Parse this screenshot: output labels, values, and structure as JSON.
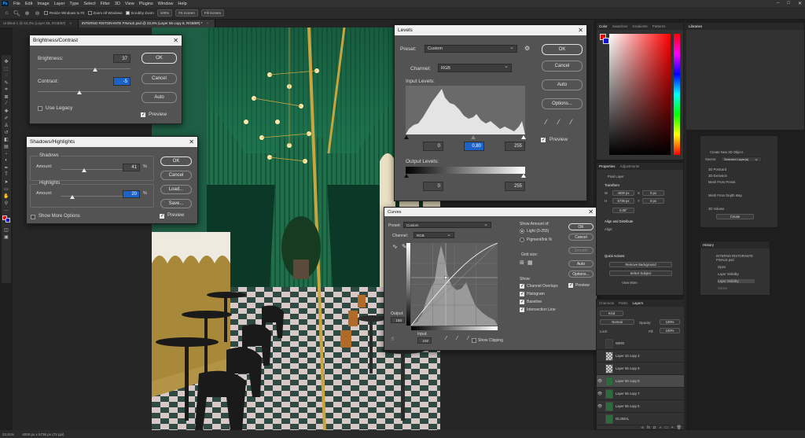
{
  "app": {
    "menu": [
      "File",
      "Edit",
      "Image",
      "Layer",
      "Type",
      "Select",
      "Filter",
      "3D",
      "View",
      "Plugins",
      "Window",
      "Help"
    ],
    "logo": "Ps"
  },
  "options_bar": {
    "resize_windows": "Resize Windows to Fit",
    "zoom_all_windows": "Zoom All Windows",
    "scrubby_zoom": "Scrubby Zoom",
    "zoom_pct": "100%",
    "fit_screen": "Fit Screen",
    "fill_screen": "Fill Screen"
  },
  "tabs": [
    {
      "label": "Untitled-1 @ 63,3% (Layer 58, RGB/8#)"
    },
    {
      "label": "INTERNO RISTORANTE FINALE.psd @ 22,9% (Layer 55 copy 8, RGB/8#) *"
    }
  ],
  "status": {
    "zoom": "22,91%",
    "doc_size": "4000 px x 5736 px (72 ppi)"
  },
  "brightness_contrast": {
    "title": "Brightness/Contrast",
    "brightness_label": "Brightness:",
    "brightness_value": "37",
    "contrast_label": "Contrast:",
    "contrast_value": "-5",
    "use_legacy_label": "Use Legacy",
    "ok": "OK",
    "cancel": "Cancel",
    "auto": "Auto",
    "preview_label": "Preview"
  },
  "shadows_highlights": {
    "title": "Shadows/Highlights",
    "shadows_group": "Shadows",
    "shadows_amount_label": "Amount:",
    "shadows_amount": "41",
    "highlights_group": "Highlights",
    "highlights_amount_label": "Amount:",
    "highlights_amount": "20",
    "percent": "%",
    "show_more_label": "Show More Options",
    "preview_label": "Preview",
    "ok": "OK",
    "cancel": "Cancel",
    "load": "Load...",
    "save": "Save..."
  },
  "levels": {
    "title": "Levels",
    "preset_label": "Preset:",
    "preset_value": "Custom",
    "channel_label": "Channel:",
    "channel_value": "RGB",
    "input_levels_label": "Input Levels:",
    "input_black": "0",
    "input_gamma": "0,80",
    "input_white": "255",
    "output_levels_label": "Output Levels:",
    "output_black": "0",
    "output_white": "255",
    "ok": "OK",
    "cancel": "Cancel",
    "auto": "Auto",
    "options": "Options...",
    "preview_label": "Preview"
  },
  "curves": {
    "title": "Curves",
    "preset_label": "Preset:",
    "preset_value": "Custom",
    "channel_label": "Channel:",
    "channel_value": "RGB",
    "output_label": "Output:",
    "output_value": "150",
    "input_label": "Input:",
    "input_value": "102",
    "show_clipping_label": "Show Clipping",
    "show_amount_label": "Show Amount of:",
    "light_label": "Light (0-255)",
    "pigment_label": "Pigment/Ink %",
    "grid_size_label": "Grid size:",
    "show_label": "Show:",
    "channel_overlays": "Channel Overlays",
    "histogram": "Histogram",
    "baseline": "Baseline",
    "intersection_line": "Intersection Line",
    "ok": "OK",
    "cancel": "Cancel",
    "smooth": "Smooth",
    "auto": "Auto",
    "options": "Options...",
    "preview_label": "Preview"
  },
  "color_panel": {
    "tabs": [
      "Color",
      "Swatches",
      "Gradients",
      "Patterns"
    ]
  },
  "libraries_panel": {
    "tabs": [
      "Libraries"
    ]
  },
  "properties_panel": {
    "tabs": [
      "Properties",
      "Adjustments"
    ],
    "pixel_layer": "Pixel Layer",
    "transform": "Transform",
    "w_value": "4000 px",
    "h_value": "5736 px",
    "x_value": "0 px",
    "y_value": "0 px",
    "angle_value": "0,00°",
    "align_distribute": "Align and Distribute",
    "align_label": "Align:",
    "quick_actions": "Quick Actions",
    "remove_background": "Remove Background",
    "select_subject": "Select Subject",
    "view_more": "View More"
  },
  "threed_panel": {
    "title": "Create New 3D Object",
    "source_label": "Source:",
    "source_value": "Selected Layer(s)",
    "options": [
      "3D Postcard",
      "3D Extrusion",
      "Mesh From Preset",
      "Mesh From Depth Map",
      "3D Volume"
    ],
    "create": "Create"
  },
  "history_panel": {
    "tabs": [
      "History"
    ],
    "snapshot": "INTERNO RISTORANTE FINALE.psd",
    "items": [
      "Open",
      "Layer Visibility",
      "Layer Visibility",
      "Stroke"
    ]
  },
  "layers_panel": {
    "tabs": [
      "Channels",
      "Paths",
      "Layers"
    ],
    "kind_label": "Kind",
    "blend_mode": "Normal",
    "opacity_label": "Opacity:",
    "opacity_value": "100%",
    "lock_label": "Lock:",
    "fill_label": "Fill:",
    "fill_value": "100%",
    "layers": [
      {
        "name": "WIRE"
      },
      {
        "name": "Layer 42 copy 2"
      },
      {
        "name": "Layer 55 copy 9"
      },
      {
        "name": "Layer 55 copy 8"
      },
      {
        "name": "Layer 55 copy 7"
      },
      {
        "name": "Layer 55 copy 5"
      },
      {
        "name": "GLOBAL"
      }
    ]
  }
}
